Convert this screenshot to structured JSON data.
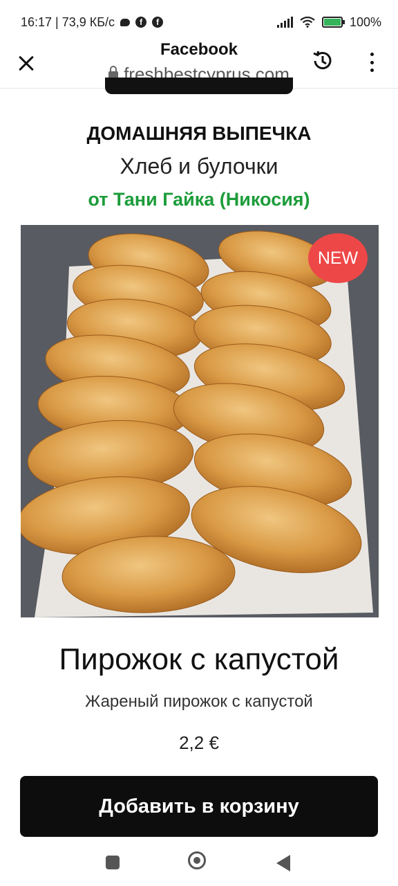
{
  "status_bar": {
    "time_speed": "16:17 | 73,9 КБ/с",
    "fb_glyph": "f",
    "battery_text": "100%",
    "battery_level": 1.0,
    "icons": [
      "message-icon",
      "facebook-icon",
      "facebook-icon",
      "signal-icon",
      "wifi-icon",
      "battery-charging-icon"
    ]
  },
  "browser": {
    "title": "Facebook",
    "url": "freshbestcyprus.com",
    "icons": [
      "close-icon",
      "lock-icon",
      "history-icon",
      "more-vert-icon"
    ]
  },
  "page": {
    "category": "ДОМАШНЯЯ ВЫПЕЧКА",
    "subcategory": "Хлеб и булочки",
    "baker": "от Тани Гайка (Никосия)",
    "badge": "NEW",
    "product_name": "Пирожок с капустой",
    "product_desc": "Жареный пирожок с капустой",
    "price": "2,2 €",
    "add_to_cart": "Добавить в корзину"
  },
  "nav": {
    "icons": [
      "recents-icon",
      "home-icon",
      "back-icon"
    ]
  },
  "colors": {
    "accent_green": "#1c9c3a",
    "badge_red": "#ee4747",
    "button_black": "#0d0d0d"
  }
}
